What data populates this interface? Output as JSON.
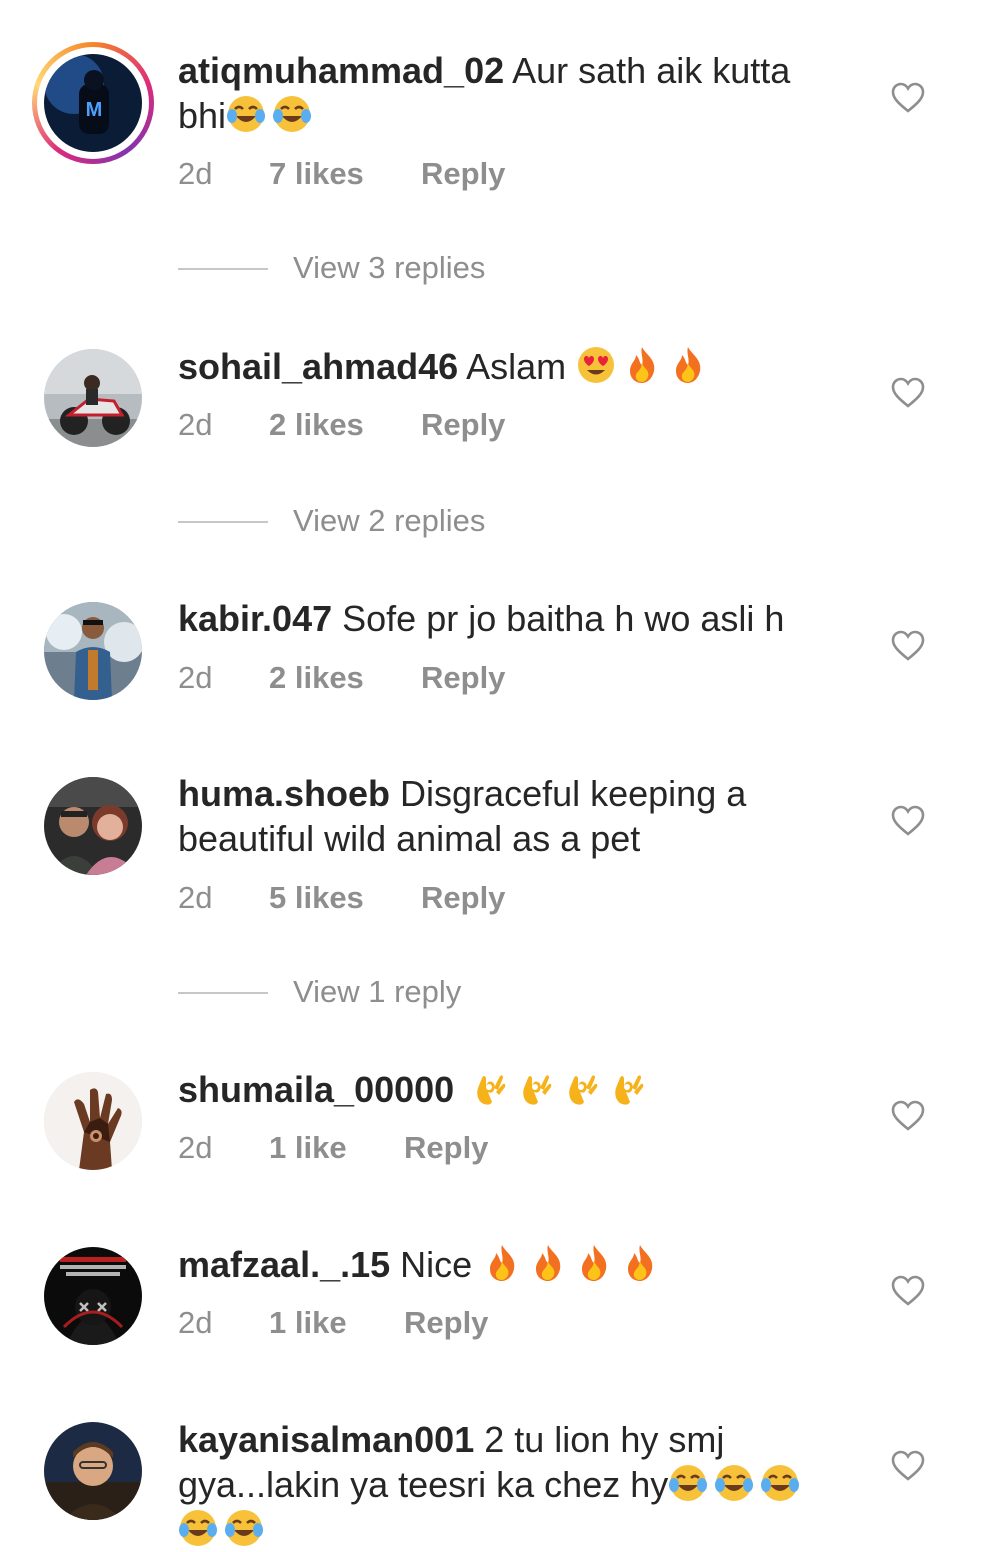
{
  "comments": [
    {
      "username": "atiqmuhammad_02",
      "text": "Aur sath aik kutta bhi",
      "emojis": [
        "joy",
        "joy"
      ],
      "time": "2d",
      "likes": "7 likes",
      "reply": "Reply",
      "view_replies": "View 3 replies",
      "has_story": true
    },
    {
      "username": "sohail_ahmad46",
      "text": "Aslam",
      "emojis": [
        "heart-eyes",
        "fire",
        "fire"
      ],
      "time": "2d",
      "likes": "2 likes",
      "reply": "Reply",
      "view_replies": "View 2 replies"
    },
    {
      "username": "kabir.047",
      "text": "Sofe pr jo baitha h wo asli h",
      "emojis": [],
      "time": "2d",
      "likes": "2 likes",
      "reply": "Reply"
    },
    {
      "username": "huma.shoeb",
      "text": "Disgraceful keeping a beautiful wild animal as a pet",
      "emojis": [],
      "time": "2d",
      "likes": "5 likes",
      "reply": "Reply",
      "view_replies": "View 1 reply"
    },
    {
      "username": "shumaila_00000",
      "text": "",
      "emojis": [
        "ok-hand",
        "ok-hand",
        "ok-hand",
        "ok-hand"
      ],
      "time": "2d",
      "likes": "1 like",
      "reply": "Reply"
    },
    {
      "username": "mafzaal._.15",
      "text": "Nice",
      "emojis": [
        "fire",
        "fire",
        "fire",
        "fire"
      ],
      "time": "2d",
      "likes": "1 like",
      "reply": "Reply"
    },
    {
      "username": "kayanisalman001",
      "text": "2 tu lion hy smj gya...lakin ya teesri ka chez hy",
      "emojis": [
        "joy",
        "joy",
        "joy",
        "joy",
        "joy"
      ],
      "time": "",
      "likes": "",
      "reply": ""
    }
  ],
  "icons": {
    "like": "heart-outline-icon",
    "joy": "face-with-tears-of-joy-emoji",
    "fire": "fire-emoji",
    "heart-eyes": "smiling-face-with-heart-eyes-emoji",
    "ok-hand": "ok-hand-emoji"
  },
  "colors": {
    "text": "#262626",
    "secondary": "#8e8e8e",
    "divider": "#c7c7c7"
  }
}
